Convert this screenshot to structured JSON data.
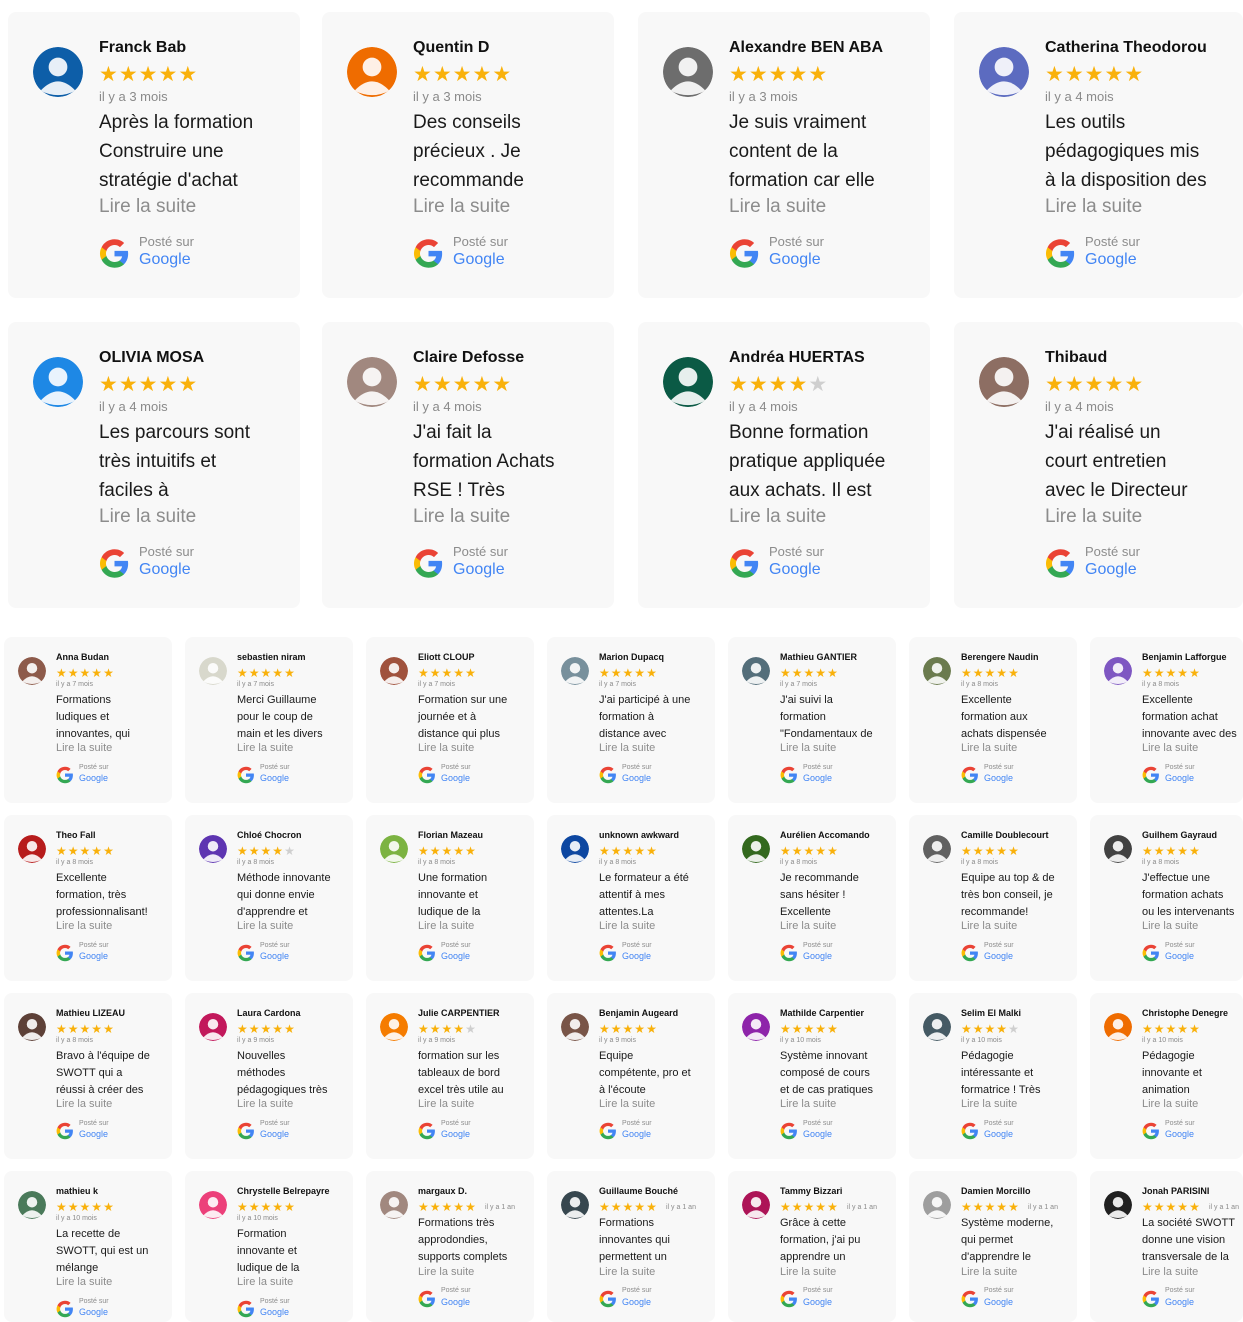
{
  "labels": {
    "read_more": "Lire la suite",
    "posted_on": "Posté sur",
    "platform": "Google"
  },
  "colors": {
    "star": "#f9b10b",
    "star_empty": "#cfcfcf",
    "google_blue": "#4285f4",
    "card_bg": "#f8f8f8"
  },
  "icons": {
    "avatar": "user-avatar-icon",
    "star": "star-icon",
    "google": "google-logo-icon"
  },
  "large_reviews": [
    {
      "name": "Franck Bab",
      "rating": 5,
      "date": "il y a 3 mois",
      "text": [
        "Après la formation",
        "Construire une",
        "stratégie d'achat"
      ],
      "avatar": "#0d5ea8"
    },
    {
      "name": "Quentin D",
      "rating": 5,
      "date": "il y a 3 mois",
      "text": [
        "Des conseils",
        "précieux . Je",
        "recommande"
      ],
      "avatar": "#ef6c00"
    },
    {
      "name": "Alexandre BEN ABA",
      "rating": 5,
      "date": "il y a 3 mois",
      "text": [
        "Je suis vraiment",
        "content de la",
        "formation car elle"
      ],
      "avatar": "#6d6d6d"
    },
    {
      "name": "Catherina Theodorou",
      "rating": 5,
      "date": "il y a 4 mois",
      "text": [
        "Les outils",
        "pédagogiques mis",
        "à la disposition des"
      ],
      "avatar": "#5c6bc0"
    },
    {
      "name": "OLIVIA MOSA",
      "rating": 5,
      "date": "il y a 4 mois",
      "text": [
        "Les parcours sont",
        "très intuitifs et",
        "faciles à"
      ],
      "avatar": "#1e88e5"
    },
    {
      "name": "Claire Defosse",
      "rating": 5,
      "date": "il y a 4 mois",
      "text": [
        "J'ai fait la",
        "formation Achats",
        "RSE ! Très"
      ],
      "avatar": "#a1887f"
    },
    {
      "name": "Andréa HUERTAS",
      "rating": 4,
      "date": "il y a 4 mois",
      "text": [
        "Bonne formation",
        "pratique appliquée",
        "aux achats. Il est"
      ],
      "avatar": "#0b5a45"
    },
    {
      "name": "Thibaud",
      "rating": 5,
      "date": "il y a 4 mois",
      "text": [
        "J'ai réalisé un",
        "court entretien",
        "avec le Directeur"
      ],
      "avatar": "#8d6e63"
    }
  ],
  "small_reviews": [
    {
      "name": "Anna Budan",
      "rating": 5,
      "date": "il y a 7 mois",
      "text": [
        "Formations",
        "ludiques et",
        "innovantes, qui"
      ],
      "avatar": "#8d5a4a"
    },
    {
      "name": "sebastien niram",
      "rating": 5,
      "date": "il y a 7 mois",
      "text": [
        "Merci Guillaume",
        "pour le coup de",
        "main et les divers"
      ],
      "avatar": "#d8d8cc"
    },
    {
      "name": "Eliott CLOUP",
      "rating": 5,
      "date": "il y a 7 mois",
      "text": [
        "Formation sur une",
        "journée et à",
        "distance qui plus"
      ],
      "avatar": "#a0523d"
    },
    {
      "name": "Marion Dupacq",
      "rating": 5,
      "date": "il y a 7 mois",
      "text": [
        "J'ai participé à une",
        "formation à",
        "distance avec"
      ],
      "avatar": "#78909c"
    },
    {
      "name": "Mathieu GANTIER",
      "rating": 5,
      "date": "il y a 7 mois",
      "text": [
        "J'ai suivi la",
        "formation",
        "\"Fondamentaux de"
      ],
      "avatar": "#546e7a"
    },
    {
      "name": "Berengere Naudin",
      "rating": 5,
      "date": "il y a 8 mois",
      "text": [
        "Excellente",
        "formation aux",
        "achats dispensée"
      ],
      "avatar": "#6b7b4e"
    },
    {
      "name": "Benjamin Lafforgue",
      "rating": 5,
      "date": "il y a 8 mois",
      "text": [
        "Excellente",
        "formation achat",
        "innovante avec des"
      ],
      "avatar": "#7e57c2"
    },
    {
      "name": "Theo Fall",
      "rating": 5,
      "date": "il y a 8 mois",
      "text": [
        "Excellente",
        "formation, très",
        "professionnalisant!"
      ],
      "avatar": "#b71c1c"
    },
    {
      "name": "Chloé Chocron",
      "rating": 4,
      "date": "il y a 8 mois",
      "text": [
        "Méthode innovante",
        "qui donne envie",
        "d'apprendre et"
      ],
      "avatar": "#5e35b1"
    },
    {
      "name": "Florian Mazeau",
      "rating": 5,
      "date": "il y a 8 mois",
      "text": [
        "Une formation",
        "innovante et",
        "ludique de la"
      ],
      "avatar": "#7cb342"
    },
    {
      "name": "unknown awkward",
      "rating": 5,
      "date": "il y a 8 mois",
      "text": [
        "Le formateur a été",
        "attentif à mes",
        "attentes.La"
      ],
      "avatar": "#0d47a1"
    },
    {
      "name": "Aurélien Accomando",
      "rating": 5,
      "date": "il y a 8 mois",
      "text": [
        "Je recommande",
        "sans hésiter !",
        "Excellente"
      ],
      "avatar": "#33691e"
    },
    {
      "name": "Camille Doublecourt",
      "rating": 5,
      "date": "il y a 8 mois",
      "text": [
        "Equipe au top & de",
        "très bon conseil, je",
        "recommande!"
      ],
      "avatar": "#616161"
    },
    {
      "name": "Guilhem Gayraud",
      "rating": 5,
      "date": "il y a 8 mois",
      "text": [
        "J'effectue une",
        "formation achats",
        "ou les intervenants"
      ],
      "avatar": "#424242"
    },
    {
      "name": "Mathieu LIZEAU",
      "rating": 5,
      "date": "il y a 8 mois",
      "text": [
        "Bravo à l'équipe de",
        "SWOTT qui a",
        "réussi à créer des"
      ],
      "avatar": "#5d4037"
    },
    {
      "name": "Laura Cardona",
      "rating": 5,
      "date": "il y a 9 mois",
      "text": [
        "Nouvelles",
        "méthodes",
        "pédagogiques très"
      ],
      "avatar": "#c2185b"
    },
    {
      "name": "Julie CARPENTIER",
      "rating": 4,
      "date": "il y a 9 mois",
      "text": [
        "formation sur les",
        "tableaux de bord",
        "excel très utile au"
      ],
      "avatar": "#f57c00"
    },
    {
      "name": "Benjamin Augeard",
      "rating": 5,
      "date": "il y a 9 mois",
      "text": [
        "Equipe",
        "compétente, pro et",
        "à l'écoute"
      ],
      "avatar": "#795548"
    },
    {
      "name": "Mathilde Carpentier",
      "rating": 5,
      "date": "il y a 10 mois",
      "text": [
        "Système innovant",
        "composé de cours",
        "et de cas pratiques"
      ],
      "avatar": "#8e24aa"
    },
    {
      "name": "Selim El Malki",
      "rating": 4,
      "date": "il y a 10 mois",
      "text": [
        "Pédagogie",
        "intéressante et",
        "formatrice ! Très"
      ],
      "avatar": "#455a64"
    },
    {
      "name": "Christophe Denegre",
      "rating": 5,
      "date": "il y a 10 mois",
      "text": [
        "Pédagogie",
        "innovante et",
        "animation"
      ],
      "avatar": "#ef6c00"
    },
    {
      "name": "mathieu k",
      "rating": 5,
      "date": "il y a 10 mois",
      "text": [
        "La recette de",
        "SWOTT, qui est un",
        "mélange"
      ],
      "avatar": "#4a7a5a"
    },
    {
      "name": "Chrystelle Belrepayre",
      "rating": 5,
      "date": "il y a 10 mois",
      "text": [
        "Formation",
        "innovante et",
        "ludique de la"
      ],
      "avatar": "#ec407a"
    },
    {
      "name": "margaux D.",
      "rating": 5,
      "date": "il y a 1 an",
      "text": [
        "Formations très",
        "approdondies,",
        "supports complets"
      ],
      "avatar": "#a1887f"
    },
    {
      "name": "Guillaume Bouché",
      "rating": 5,
      "date": "il y a 1 an",
      "text": [
        "Formations",
        "innovantes qui",
        "permettent un"
      ],
      "avatar": "#37474f"
    },
    {
      "name": "Tammy Bizzari",
      "rating": 5,
      "date": "il y a 1 an",
      "text": [
        "Grâce à cette",
        "formation, j'ai pu",
        "apprendre un"
      ],
      "avatar": "#ad1457"
    },
    {
      "name": "Damien Morcillo",
      "rating": 5,
      "date": "il y a 1 an",
      "text": [
        "Système moderne,",
        "qui permet",
        "d'apprendre le"
      ],
      "avatar": "#9e9e9e"
    },
    {
      "name": "Jonah PARISINI",
      "rating": 5,
      "date": "il y a 1 an",
      "text": [
        "La société SWOTT",
        "donne une vision",
        "transversale de la"
      ],
      "avatar": "#212121"
    }
  ]
}
